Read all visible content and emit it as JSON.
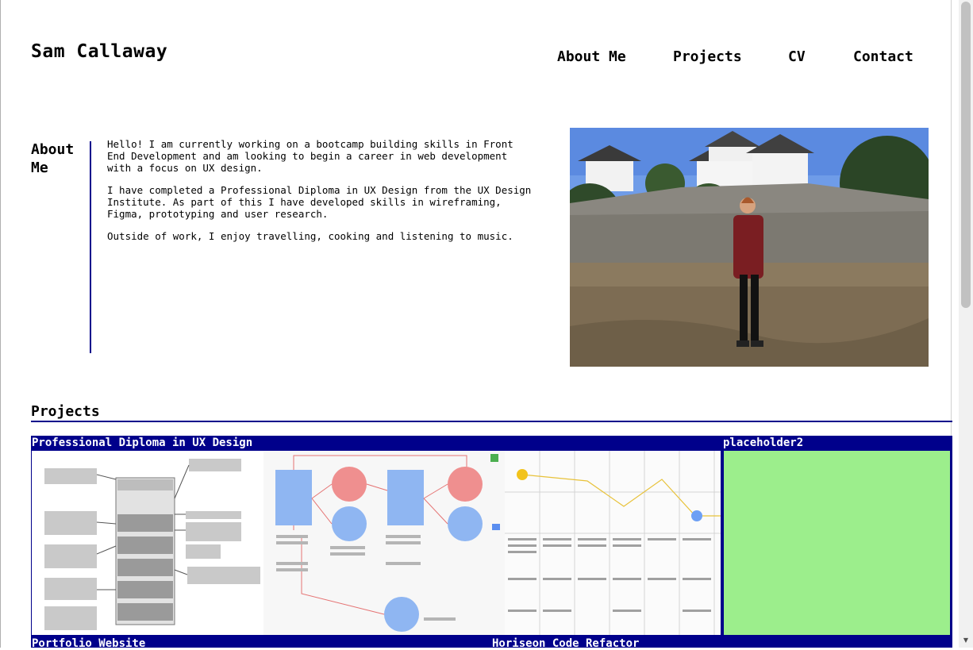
{
  "header": {
    "site_name": "Sam Callaway",
    "nav": [
      "About Me",
      "Projects",
      "CV",
      "Contact"
    ]
  },
  "about": {
    "heading": "About Me",
    "paragraphs": [
      "Hello! I am currently working on a bootcamp building skills in Front End Development and am looking to begin a career in web development with a focus on UX design.",
      "I have completed a Professional Diploma in UX Design from the UX Design Institute. As part of this I have developed skills in wireframing, Figma, prototyping and user research.",
      "Outside of work, I enjoy travelling, cooking and listening to music."
    ]
  },
  "projects": {
    "heading": "Projects",
    "cards": [
      {
        "title": "Professional Diploma in UX Design"
      },
      {
        "title": "placeholder2"
      },
      {
        "title": "Portfolio Website"
      },
      {
        "title": "Horiseon Code Refactor"
      }
    ]
  },
  "colors": {
    "accent": "#00008b",
    "placeholder_green": "#9cee8c"
  }
}
